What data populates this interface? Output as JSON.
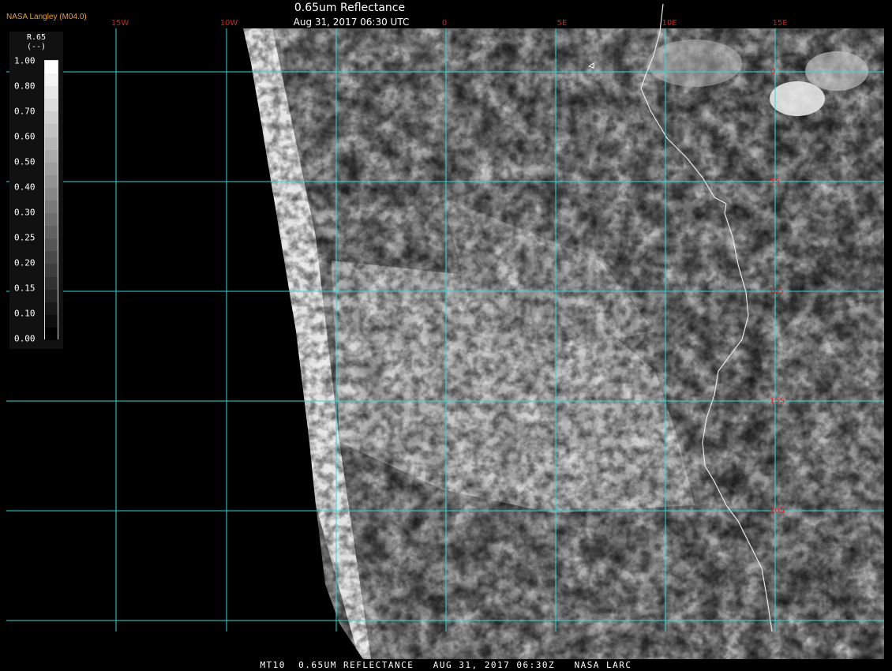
{
  "header": {
    "logo": "NASA Langley (M04.0)",
    "title": "0.65um Reflectance",
    "subtitle": "Aug 31, 2017 06:30 UTC"
  },
  "footer": {
    "text": "MT10  0.65UM REFLECTANCE   AUG 31, 2017 06:30Z   NASA LARC"
  },
  "grid": {
    "longitudes": [
      "15W",
      "10W",
      "0",
      "5E",
      "10E",
      "15E"
    ],
    "latitudes": [
      "0",
      "5S",
      "10S",
      "15S",
      "20S"
    ],
    "line_color": "#30d8d8",
    "label_color": "#d02020"
  },
  "legend": {
    "title": "R.65",
    "unit": "(--)",
    "ticks": [
      "1.00",
      "0.80",
      "0.70",
      "0.60",
      "0.50",
      "0.40",
      "0.30",
      "0.25",
      "0.20",
      "0.15",
      "0.10",
      "0.00"
    ]
  }
}
